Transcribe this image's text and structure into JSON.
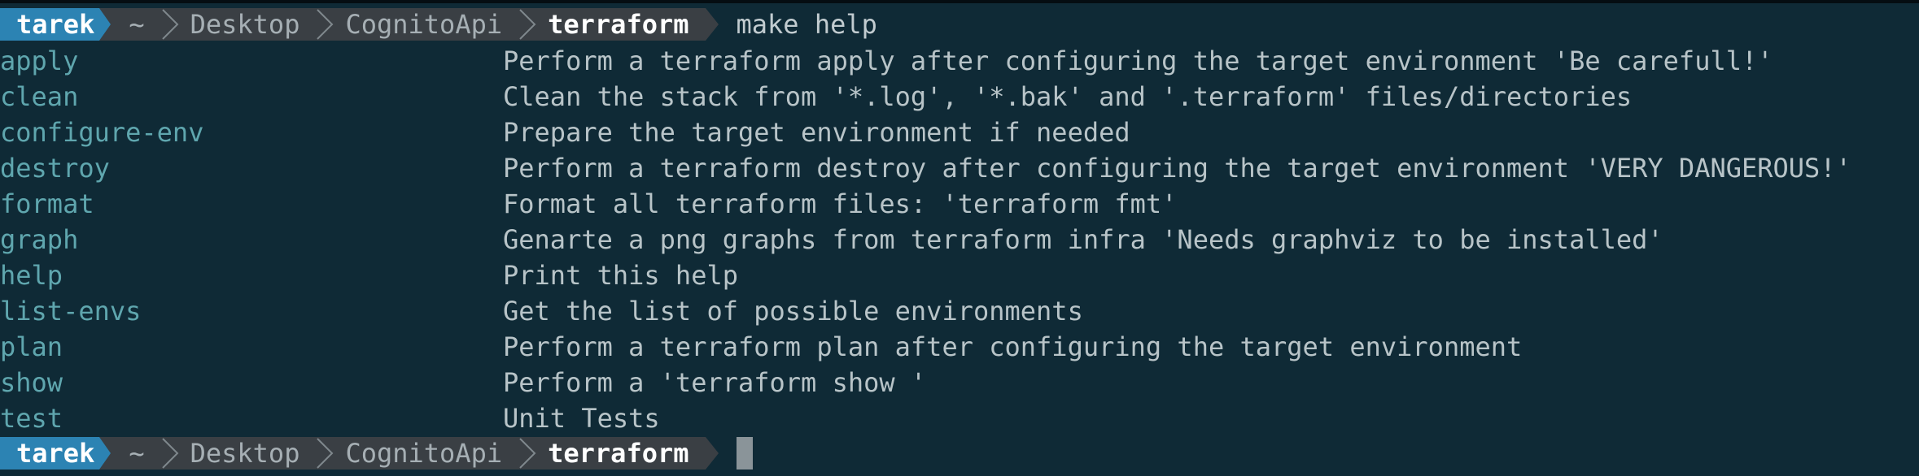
{
  "window": {
    "title": "make help"
  },
  "prompts": [
    {
      "user": "tarek",
      "home": "~",
      "path": [
        "Desktop",
        "CognitoApi"
      ],
      "current_dir": "terraform",
      "command": "make help"
    },
    {
      "user": "tarek",
      "home": "~",
      "path": [
        "Desktop",
        "CognitoApi"
      ],
      "current_dir": "terraform",
      "command": ""
    }
  ],
  "help_output": [
    {
      "target": "apply",
      "description": "Perform a terraform apply after configuring the target environment 'Be carefull!'"
    },
    {
      "target": "clean",
      "description": "Clean the stack from '*.log', '*.bak' and '.terraform' files/directories"
    },
    {
      "target": "configure-env",
      "description": "Prepare the target environment if needed"
    },
    {
      "target": "destroy",
      "description": "Perform a terraform destroy after configuring the target environment 'VERY DANGEROUS!'"
    },
    {
      "target": "format",
      "description": "Format all terraform files: 'terraform fmt'"
    },
    {
      "target": "graph",
      "description": "Genarte a png graphs from terraform infra 'Needs graphviz to be installed'"
    },
    {
      "target": "help",
      "description": "Print this help"
    },
    {
      "target": "list-envs",
      "description": "Get the list of possible environments"
    },
    {
      "target": "plan",
      "description": "Perform a terraform plan after configuring the target environment"
    },
    {
      "target": "show",
      "description": "Perform a 'terraform show '"
    },
    {
      "target": "test",
      "description": "Unit Tests"
    }
  ],
  "colors": {
    "background": "#0f2a36",
    "user_segment": "#2c83b3",
    "path_segment": "#3a3f44",
    "target_name": "#5fa6ae",
    "description_text": "#b8c4c8",
    "cursor": "#8a9499"
  }
}
